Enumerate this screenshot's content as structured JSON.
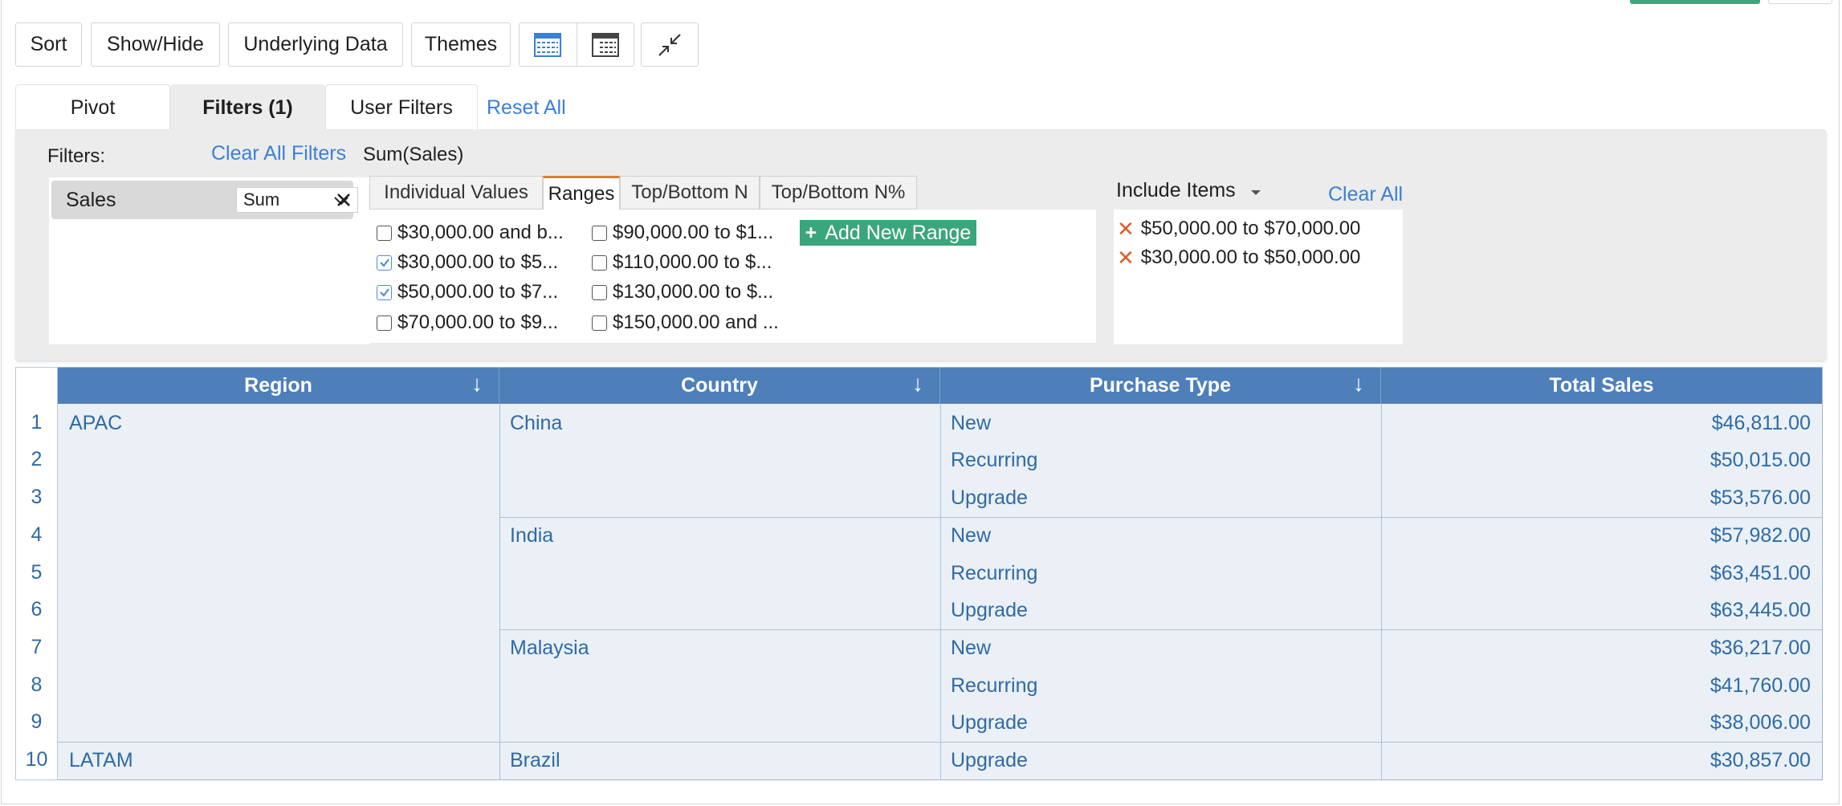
{
  "toolbar": {
    "sort": "Sort",
    "show_hide": "Show/Hide",
    "underlying_data": "Underlying Data",
    "themes": "Themes"
  },
  "tabs": {
    "pivot": "Pivot",
    "filters": "Filters  (1)",
    "user_filters": "User Filters",
    "reset_all": "Reset All"
  },
  "filters_panel": {
    "filters_label": "Filters:",
    "clear_all_filters": "Clear All Filters",
    "field_name": "Sales",
    "aggregate": "Sum",
    "filter_title": "Sum(Sales)",
    "subtabs": [
      "Individual Values",
      "Ranges",
      "Top/Bottom N",
      "Top/Bottom N%"
    ],
    "ranges_col1": [
      {
        "label": "$30,000.00 and b...",
        "checked": false
      },
      {
        "label": "$30,000.00 to $5...",
        "checked": true
      },
      {
        "label": "$50,000.00 to $7...",
        "checked": true
      },
      {
        "label": "$70,000.00 to $9...",
        "checked": false
      }
    ],
    "ranges_col2": [
      {
        "label": "$90,000.00 to $1...",
        "checked": false
      },
      {
        "label": "$110,000.00 to $...",
        "checked": false
      },
      {
        "label": "$130,000.00 to $...",
        "checked": false
      },
      {
        "label": "$150,000.00 and ...",
        "checked": false
      }
    ],
    "add_new_range": "Add New Range",
    "include_items_label": "Include Items",
    "clear_all": "Clear All",
    "included_items": [
      "$50,000.00 to $70,000.00",
      "$30,000.00 to $50,000.00"
    ]
  },
  "table": {
    "headers": [
      "Region",
      "Country",
      "Purchase Type",
      "Total Sales"
    ],
    "row_numbers": [
      "1",
      "2",
      "3",
      "4",
      "5",
      "6",
      "7",
      "8",
      "9",
      "10"
    ],
    "regions": [
      "APAC",
      "LATAM"
    ],
    "countries": [
      "China",
      "India",
      "Malaysia",
      "Brazil"
    ],
    "purchase_types": [
      "New",
      "Recurring",
      "Upgrade",
      "New",
      "Recurring",
      "Upgrade",
      "New",
      "Recurring",
      "Upgrade",
      "Upgrade"
    ],
    "totals": [
      "$46,811.00",
      "$50,015.00",
      "$53,576.00",
      "$57,982.00",
      "$63,451.00",
      "$63,445.00",
      "$36,217.00",
      "$41,760.00",
      "$38,006.00",
      "$30,857.00"
    ]
  },
  "colors": {
    "accent_green": "#3aa67c",
    "link_blue": "#3b7fd9",
    "header_blue": "#4e7fb9",
    "active_tab_underline": "#e07a3c",
    "remove_x": "#e05a2a"
  }
}
